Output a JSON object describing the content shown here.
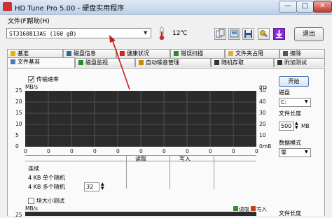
{
  "window": {
    "title": "HD Tune Pro 5.00 - 硬盘实用程序",
    "minimize": "—",
    "maximize": "□",
    "close": "✕"
  },
  "menu": {
    "file": "文件(F)",
    "help": "帮助(H)"
  },
  "toolbar": {
    "drive": "ST3160813AS (160 gB)",
    "temperature": "12℃",
    "exit": "退出"
  },
  "tabs_top": [
    {
      "label": "基准",
      "icon": "info-icon",
      "color": "#e8b400"
    },
    {
      "label": "磁盘信息",
      "icon": "disk-info-icon",
      "color": "#336699"
    },
    {
      "label": "健康状况",
      "icon": "health-cross-icon",
      "color": "#d42020"
    },
    {
      "label": "错误扫描",
      "icon": "error-scan-icon",
      "color": "#2a8a2a"
    },
    {
      "label": "文件夹占用",
      "icon": "folder-icon",
      "color": "#e0b030"
    },
    {
      "label": "擦除",
      "icon": "erase-icon",
      "color": "#555555"
    }
  ],
  "tabs_bottom": [
    {
      "label": "文件基准",
      "icon": "file-bench-icon",
      "color": "#4a7ab8"
    },
    {
      "label": "磁盘监视",
      "icon": "monitor-icon",
      "color": "#2a8a2a"
    },
    {
      "label": "自动噪音管理",
      "icon": "speaker-icon",
      "color": "#c88a00"
    },
    {
      "label": "随机存取",
      "icon": "random-access-icon",
      "color": "#333333"
    },
    {
      "label": "附加测试",
      "icon": "extra-tests-icon",
      "color": "#333333"
    }
  ],
  "benchmark": {
    "transfer_rate_label": "传输速率",
    "y_unit_left": "MB/s",
    "y_unit_right": "ms",
    "y_left_ticks": [
      "25",
      "20",
      "15",
      "10",
      "5",
      "0"
    ],
    "y_right_ticks": [
      "50",
      "40",
      "30",
      "20",
      "10",
      "0mB"
    ],
    "x_ticks": [
      "0",
      "0",
      "0",
      "0",
      "0",
      "0",
      "0",
      "0",
      "0",
      "0",
      "0"
    ],
    "read_label": "读取",
    "write_label": "写入",
    "continuous_label": "连续",
    "random_4k_label": "4 KB 单个随机",
    "random_4k_multi_label": "4 KB 多个随机",
    "queue_depth": "32",
    "block_size_label": "块大小测试",
    "block_unit": "MB/s",
    "block_y_first": "25",
    "block_read_legend": "读取",
    "block_write_legend": "写入",
    "block_file_length_label": "文件长度"
  },
  "side": {
    "start": "开始",
    "disk_label": "磁盘",
    "disk_value": "C:",
    "file_length_label": "文件长度",
    "file_length_value": "500",
    "file_length_unit": "MB",
    "data_mode_label": "数据模式",
    "data_mode_value": "零"
  },
  "colors": {
    "chart_bg": "#2b2b2b",
    "grid": "#5c5c5c",
    "read": "#3a8a3a",
    "write": "#c04020",
    "annotation_arrow": "#cc1a1a"
  }
}
